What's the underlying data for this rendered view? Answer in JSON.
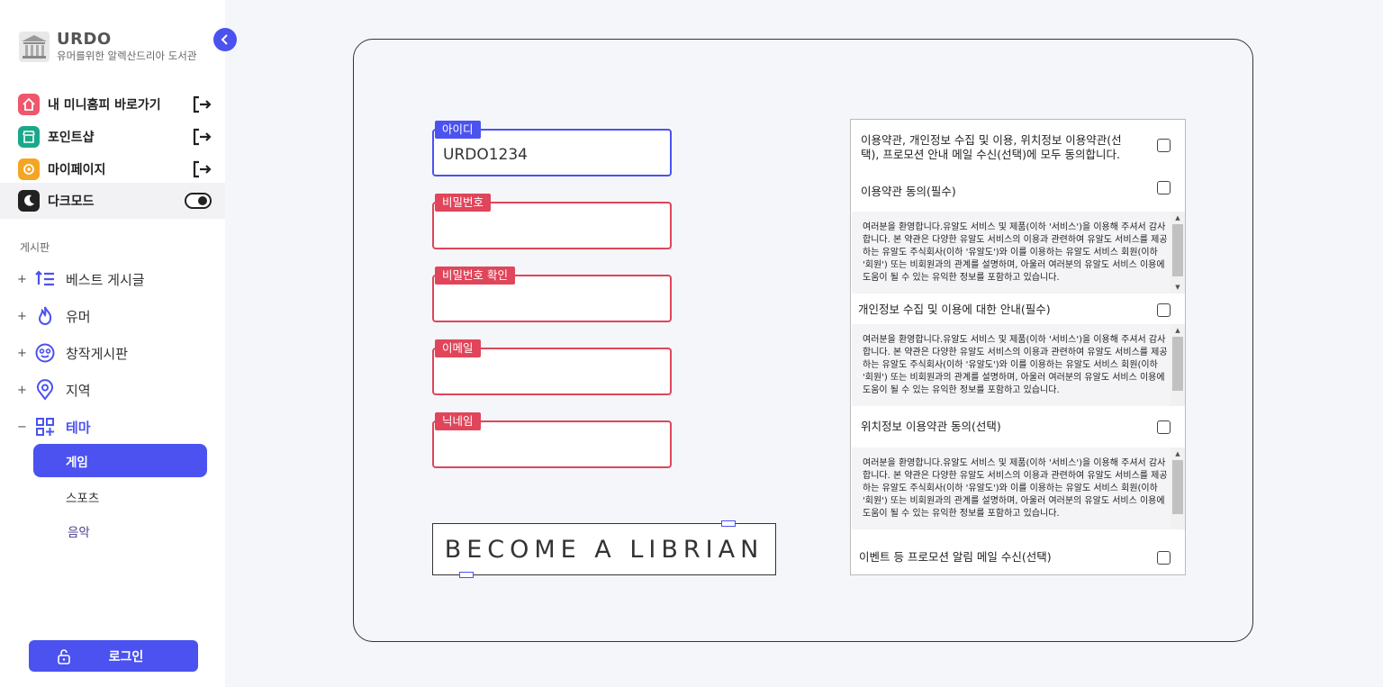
{
  "brand": {
    "title": "URDO",
    "subtitle": "유머를위한 알렉산드리아 도서관"
  },
  "quick_links": [
    {
      "label": "내 미니홈피 바로가기",
      "icon": "home-icon",
      "color": "#f0566c"
    },
    {
      "label": "포인트샵",
      "icon": "shop-icon",
      "color": "#1aa88a"
    },
    {
      "label": "마이페이지",
      "icon": "gear-icon",
      "color": "#f5a524"
    }
  ],
  "dark_mode": {
    "label": "다크모드",
    "icon": "moon-icon"
  },
  "board": {
    "section_title": "게시판",
    "items": [
      {
        "sign": "+",
        "label": "베스트 게시글",
        "icon": "list-icon"
      },
      {
        "sign": "+",
        "label": "유머",
        "icon": "fire-icon"
      },
      {
        "sign": "+",
        "label": "창작게시판",
        "icon": "smile-icon"
      },
      {
        "sign": "+",
        "label": "지역",
        "icon": "location-icon"
      },
      {
        "sign": "−",
        "label": "테마",
        "icon": "grid-add-icon"
      }
    ],
    "theme_sub": [
      "게임",
      "스포츠",
      "음악"
    ]
  },
  "login": {
    "label": "로그인"
  },
  "form": {
    "id_label": "아이디",
    "id_value": "URDO1234",
    "password_label": "비밀번호",
    "password_confirm_label": "비밀번호 확인",
    "email_label": "이메일",
    "nickname_label": "닉네임",
    "submit_label": "BECOME A LIBRIAN"
  },
  "terms": {
    "agree_all": "이용약관, 개인정보 수집 및 이용, 위치정보 이용약관(선택), 프로모션 안내 메일 수신(선택)에 모두 동의합니다.",
    "tos": "이용약관 동의(필수)",
    "privacy": "개인정보 수집 및 이용에 대한 안내(필수)",
    "location": "위치정보 이용약관 동의(선택)",
    "event": "이벤트 등 프로모션 알림 메일 수신(선택)",
    "body": "여러분을 환영합니다.유알도 서비스 및 제품(이하 '서비스')을 이용해 주셔서 감사합니다. 본 약관은 다양한 유알도 서비스의 이용과 관련하여 유알도 서비스를 제공하는 유알도 주식회사(이하 '유알도')와 이를 이용하는 유알도 서비스 회원(이하 '회원') 또는 비회원과의 관계를 설명하며, 아울러 여러분의 유알도 서비스 이용에 도움이 될 수 있는 유익한 정보를 포함하고 있습니다."
  },
  "colors": {
    "accent": "#4b52f0",
    "error": "#e0455a"
  }
}
